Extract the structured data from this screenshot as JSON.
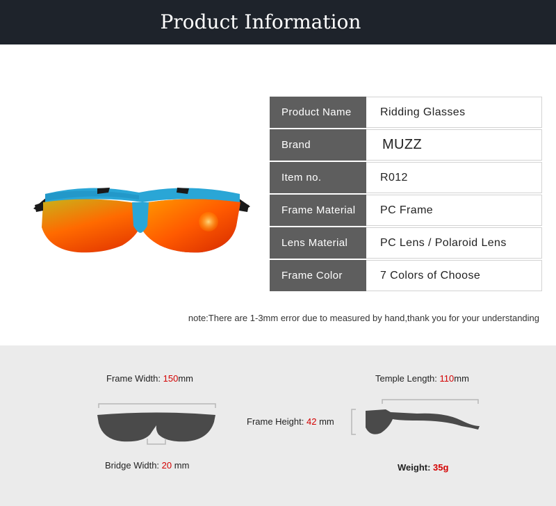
{
  "header": {
    "title": "Product Information"
  },
  "product": {
    "image_alt": "sunglasses-icon"
  },
  "specs": [
    {
      "key": "Product Name",
      "value": "Ridding Glasses"
    },
    {
      "key": "Brand",
      "value": "MUZZ"
    },
    {
      "key": "Item no.",
      "value": "R012"
    },
    {
      "key": "Frame Material",
      "value": "PC Frame"
    },
    {
      "key": "Lens Material",
      "value": "PC Lens / Polaroid Lens"
    },
    {
      "key": "Frame Color",
      "value": "7 Colors of Choose"
    }
  ],
  "note": "note:There are 1-3mm error due to measured by hand,thank you for your understanding",
  "measurements": {
    "frame_width": {
      "label": "Frame Width: ",
      "value": "150",
      "unit": "mm"
    },
    "temple_length": {
      "label": "Temple Length: ",
      "value": "110",
      "unit": "mm"
    },
    "frame_height": {
      "label": "Frame Height: ",
      "value": "42",
      "unit": " mm"
    },
    "bridge_width": {
      "label": "Bridge Width: ",
      "value": "20",
      "unit": " mm"
    },
    "weight": {
      "label": "Weight: ",
      "value": "35g"
    }
  },
  "colors": {
    "header_bg": "#1e232b",
    "key_bg": "#5e5e5e",
    "panel_bg": "#ebebeb",
    "accent_red": "#d40000",
    "frame_blue": "#2aa6d6"
  }
}
